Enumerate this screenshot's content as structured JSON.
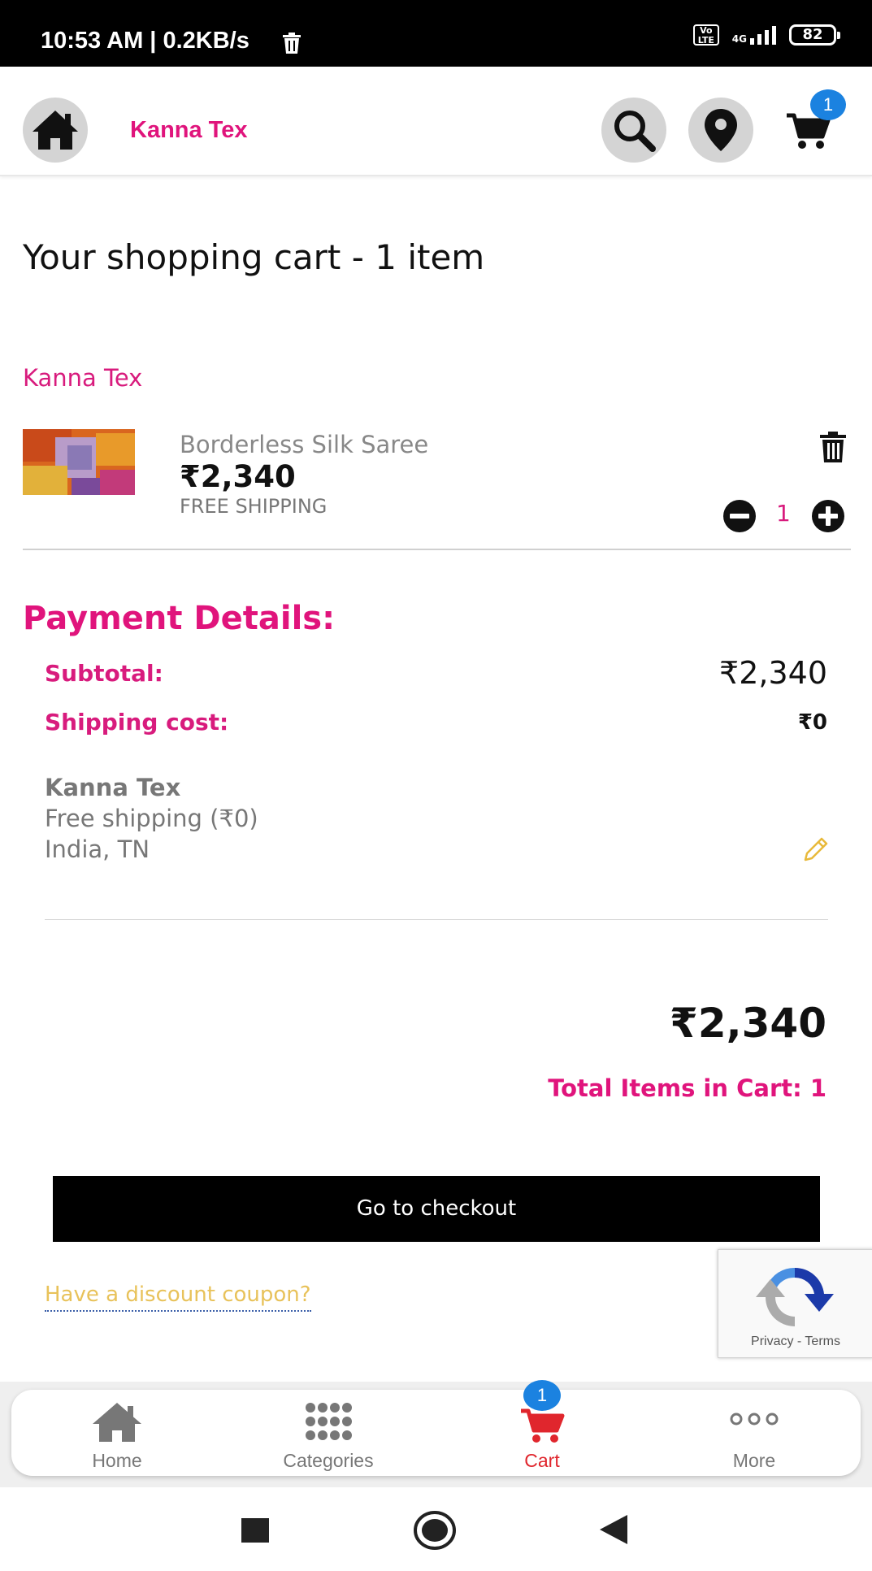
{
  "status_bar": {
    "time": "10:53 AM | 0.2KB/s",
    "network_type": "4G",
    "volte": "Vo LTE",
    "battery": "82"
  },
  "header": {
    "brand": "Kanna Tex",
    "cart_count": "1",
    "icons": [
      "home-icon",
      "search-icon",
      "location-icon",
      "cart-icon"
    ]
  },
  "cart": {
    "title": "Your shopping cart - 1 item",
    "seller": "Kanna Tex",
    "item": {
      "name": "Borderless Silk Saree",
      "price": "₹2,340",
      "shipping": "FREE SHIPPING",
      "quantity": "1"
    }
  },
  "payment": {
    "title": "Payment Details:",
    "subtotal_label": "Subtotal:",
    "subtotal_value": "₹2,340",
    "shipping_label": "Shipping cost:",
    "shipping_value": "₹0",
    "ship_seller": "Kanna Tex",
    "ship_method": "Free shipping (₹0)",
    "ship_region": "India, TN",
    "grand_total": "₹2,340",
    "total_items": "Total Items in Cart: 1"
  },
  "actions": {
    "checkout": "Go to checkout",
    "coupon": "Have a discount coupon?"
  },
  "recaptcha": {
    "links": "Privacy - Terms"
  },
  "bottom_nav": {
    "items": [
      {
        "label": "Home",
        "icon": "home-icon"
      },
      {
        "label": "Categories",
        "icon": "grid-icon"
      },
      {
        "label": "Cart",
        "icon": "cart-icon"
      },
      {
        "label": "More",
        "icon": "more-icon"
      }
    ],
    "cart_badge": "1"
  },
  "colors": {
    "brand_pink": "#e0147c",
    "badge_blue": "#1b82e0",
    "coupon_yellow": "#e8c25a",
    "cart_active_red": "#e0262d"
  }
}
